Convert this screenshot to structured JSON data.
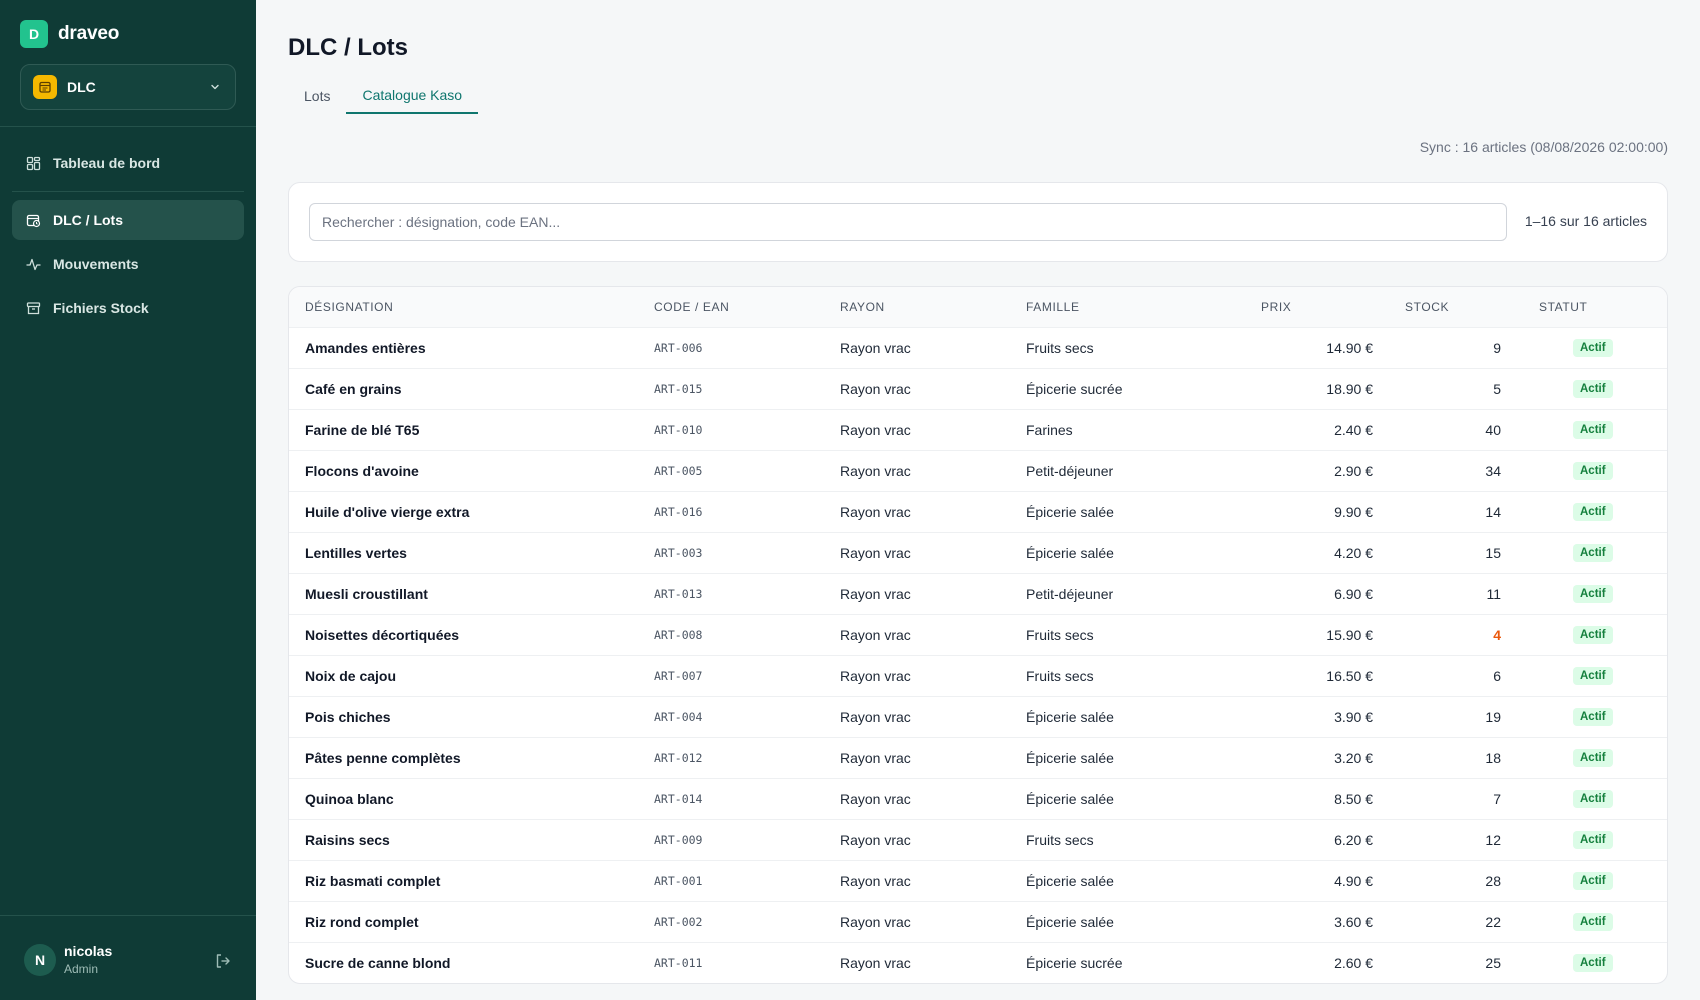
{
  "brand": {
    "logo_letter": "D",
    "name": "draveo"
  },
  "module": {
    "label": "DLC"
  },
  "nav": [
    {
      "label": "Tableau de bord",
      "icon": "dashboard-icon",
      "active": false
    },
    {
      "label": "DLC / Lots",
      "icon": "calendar-clock-icon",
      "active": true
    },
    {
      "label": "Mouvements",
      "icon": "activity-icon",
      "active": false
    },
    {
      "label": "Fichiers Stock",
      "icon": "archive-icon",
      "active": false
    }
  ],
  "user": {
    "initial": "N",
    "name": "nicolas",
    "role": "Admin"
  },
  "page": {
    "title": "DLC / Lots"
  },
  "tabs": [
    {
      "label": "Lots",
      "active": false
    },
    {
      "label": "Catalogue Kaso",
      "active": true
    }
  ],
  "sync_text": "Sync : 16 articles (08/08/2026 02:00:00)",
  "search": {
    "placeholder": "Rechercher : désignation, code EAN...",
    "value": ""
  },
  "count_text": "1–16 sur 16 articles",
  "table": {
    "columns": [
      "Désignation",
      "Code / EAN",
      "Rayon",
      "Famille",
      "Prix",
      "Stock",
      "Statut"
    ],
    "rows": [
      {
        "name": "Amandes entières",
        "code": "ART-006",
        "rayon": "Rayon vrac",
        "famille": "Fruits secs",
        "prix": "14.90 €",
        "stock": "9",
        "statut": "Actif",
        "low": false
      },
      {
        "name": "Café en grains",
        "code": "ART-015",
        "rayon": "Rayon vrac",
        "famille": "Épicerie sucrée",
        "prix": "18.90 €",
        "stock": "5",
        "statut": "Actif",
        "low": false
      },
      {
        "name": "Farine de blé T65",
        "code": "ART-010",
        "rayon": "Rayon vrac",
        "famille": "Farines",
        "prix": "2.40 €",
        "stock": "40",
        "statut": "Actif",
        "low": false
      },
      {
        "name": "Flocons d'avoine",
        "code": "ART-005",
        "rayon": "Rayon vrac",
        "famille": "Petit-déjeuner",
        "prix": "2.90 €",
        "stock": "34",
        "statut": "Actif",
        "low": false
      },
      {
        "name": "Huile d'olive vierge extra",
        "code": "ART-016",
        "rayon": "Rayon vrac",
        "famille": "Épicerie salée",
        "prix": "9.90 €",
        "stock": "14",
        "statut": "Actif",
        "low": false
      },
      {
        "name": "Lentilles vertes",
        "code": "ART-003",
        "rayon": "Rayon vrac",
        "famille": "Épicerie salée",
        "prix": "4.20 €",
        "stock": "15",
        "statut": "Actif",
        "low": false
      },
      {
        "name": "Muesli croustillant",
        "code": "ART-013",
        "rayon": "Rayon vrac",
        "famille": "Petit-déjeuner",
        "prix": "6.90 €",
        "stock": "11",
        "statut": "Actif",
        "low": false
      },
      {
        "name": "Noisettes décortiquées",
        "code": "ART-008",
        "rayon": "Rayon vrac",
        "famille": "Fruits secs",
        "prix": "15.90 €",
        "stock": "4",
        "statut": "Actif",
        "low": true
      },
      {
        "name": "Noix de cajou",
        "code": "ART-007",
        "rayon": "Rayon vrac",
        "famille": "Fruits secs",
        "prix": "16.50 €",
        "stock": "6",
        "statut": "Actif",
        "low": false
      },
      {
        "name": "Pois chiches",
        "code": "ART-004",
        "rayon": "Rayon vrac",
        "famille": "Épicerie salée",
        "prix": "3.90 €",
        "stock": "19",
        "statut": "Actif",
        "low": false
      },
      {
        "name": "Pâtes penne complètes",
        "code": "ART-012",
        "rayon": "Rayon vrac",
        "famille": "Épicerie salée",
        "prix": "3.20 €",
        "stock": "18",
        "statut": "Actif",
        "low": false
      },
      {
        "name": "Quinoa blanc",
        "code": "ART-014",
        "rayon": "Rayon vrac",
        "famille": "Épicerie salée",
        "prix": "8.50 €",
        "stock": "7",
        "statut": "Actif",
        "low": false
      },
      {
        "name": "Raisins secs",
        "code": "ART-009",
        "rayon": "Rayon vrac",
        "famille": "Fruits secs",
        "prix": "6.20 €",
        "stock": "12",
        "statut": "Actif",
        "low": false
      },
      {
        "name": "Riz basmati complet",
        "code": "ART-001",
        "rayon": "Rayon vrac",
        "famille": "Épicerie salée",
        "prix": "4.90 €",
        "stock": "28",
        "statut": "Actif",
        "low": false
      },
      {
        "name": "Riz rond complet",
        "code": "ART-002",
        "rayon": "Rayon vrac",
        "famille": "Épicerie salée",
        "prix": "3.60 €",
        "stock": "22",
        "statut": "Actif",
        "low": false
      },
      {
        "name": "Sucre de canne blond",
        "code": "ART-011",
        "rayon": "Rayon vrac",
        "famille": "Épicerie sucrée",
        "prix": "2.60 €",
        "stock": "25",
        "statut": "Actif",
        "low": false
      }
    ]
  },
  "colors": {
    "sidebar": "#0f3b36",
    "accent": "#0f766e",
    "brand": "#22c38e",
    "module": "#f5b800",
    "badge_bg": "#dcfce7",
    "badge_text": "#15803d",
    "low_stock": "#ea580c"
  }
}
